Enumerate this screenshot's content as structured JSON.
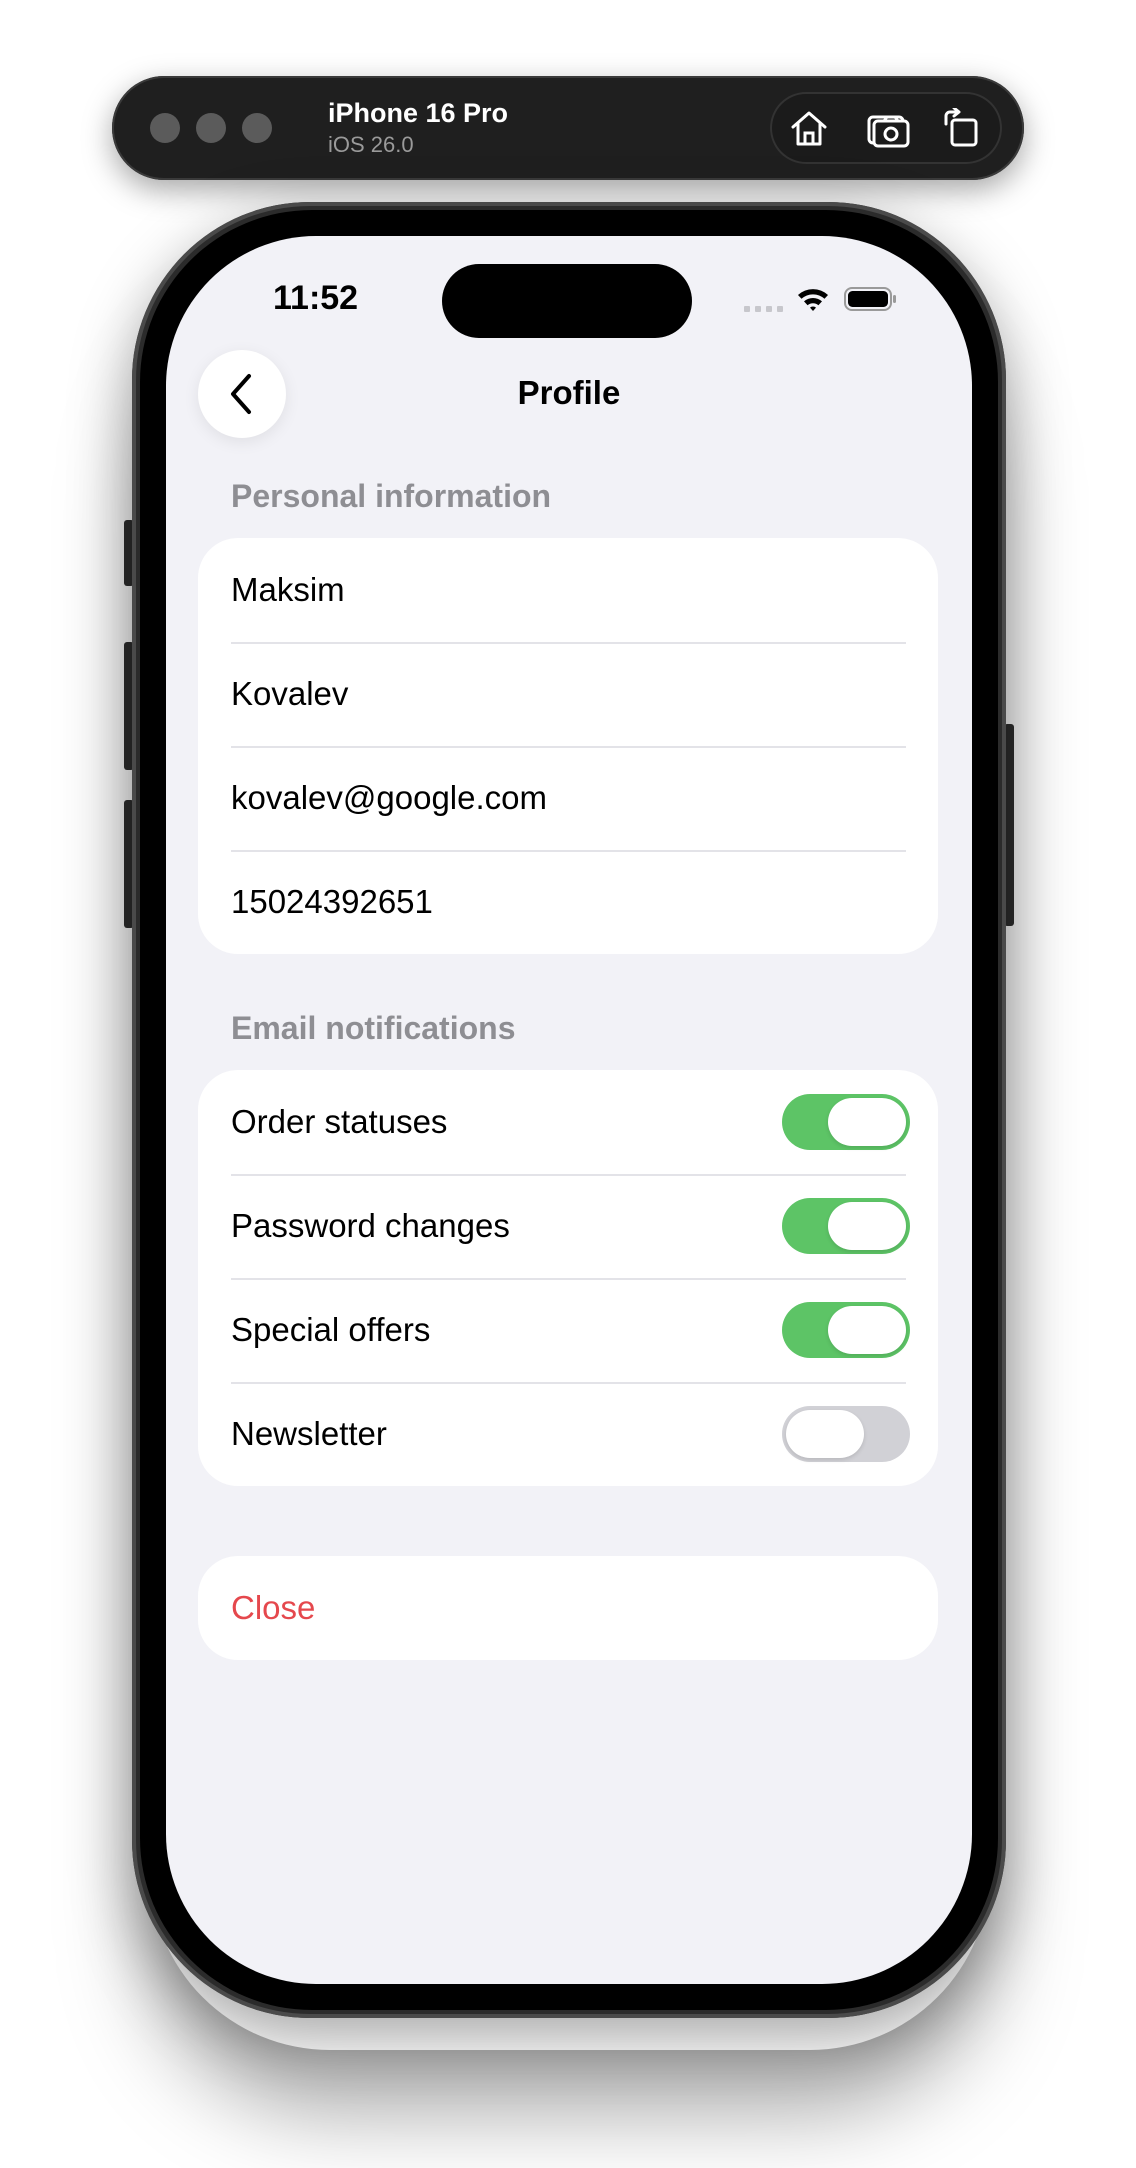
{
  "simulator": {
    "device_name": "iPhone 16 Pro",
    "os_version": "iOS 26.0",
    "toolbar": [
      "home-icon",
      "screenshot-icon",
      "rotate-icon"
    ]
  },
  "status_bar": {
    "time": "11:52"
  },
  "nav": {
    "title": "Profile"
  },
  "personal_info": {
    "header": "Personal information",
    "first_name": "Maksim",
    "last_name": "Kovalev",
    "email": "kovalev@google.com",
    "phone": "15024392651"
  },
  "notifications": {
    "header": "Email notifications",
    "items": [
      {
        "label": "Order statuses",
        "enabled": true
      },
      {
        "label": "Password changes",
        "enabled": true
      },
      {
        "label": "Special offers",
        "enabled": true
      },
      {
        "label": "Newsletter",
        "enabled": false
      }
    ]
  },
  "actions": {
    "close_label": "Close"
  },
  "colors": {
    "toggle_on": "#5dc466",
    "toggle_off": "#d1d1d6",
    "destructive": "#e5484d",
    "background": "#f2f2f7"
  }
}
